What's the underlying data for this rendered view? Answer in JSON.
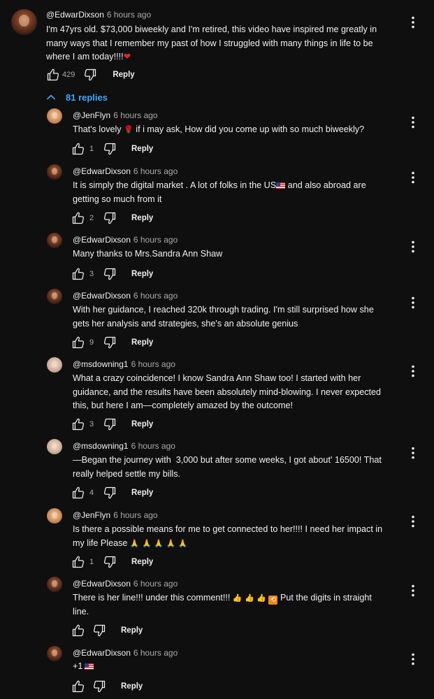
{
  "thread": {
    "top_comment": {
      "author": "@EdwarDixson",
      "time": "6 hours ago",
      "lines": [
        "I'm 47yrs old. $73,000 biweekly and I'm retired, this video have inspired me greatly in",
        "many ways that I remember my past of how I struggled with many things in life to be",
        "where I am today!!!!"
      ],
      "emoji": "❤",
      "likes": "429",
      "reply_label": "Reply"
    },
    "replies_toggle": {
      "label": "81 replies",
      "icon": "chevron-up-icon"
    },
    "replies": [
      {
        "author": "@JenFlyn",
        "time": "6 hours ago",
        "avatar": "jenflyn-avatar",
        "parts": [
          "That's lovely ",
          "🌹",
          " if i may ask, How did you come up with so much biweekly?"
        ],
        "likes": "1",
        "reply_label": "Reply"
      },
      {
        "author": "@EdwarDixson",
        "time": "6 hours ago",
        "avatar": "edwardixson-avatar",
        "line1a": "It is simply the digital market . A lot of folks in the US",
        "line1b": " and also abroad are",
        "line2": "getting so much from it",
        "likes": "2",
        "reply_label": "Reply"
      },
      {
        "author": "@EdwarDixson",
        "time": "6 hours ago",
        "avatar": "edwardixson-avatar",
        "line1": "Many thanks to Mrs.Sandra Ann Shaw",
        "likes": "3",
        "reply_label": "Reply"
      },
      {
        "author": "@EdwarDixson",
        "time": "6 hours ago",
        "avatar": "edwardixson-avatar",
        "line1": "With her guidance, I reached 320k through trading. I'm still surprised how she",
        "line2": "gets her analysis and strategies, she's an absolute genius",
        "likes": "9",
        "reply_label": "Reply"
      },
      {
        "author": "@msdowning1",
        "time": "6 hours ago",
        "avatar": "msdowning1-avatar",
        "line1": "What a crazy coincidence! I know Sandra Ann Shaw too! I started with her",
        "line2": "guidance, and the results have been absolutely mind-blowing. I never expected",
        "line3": "this, but here I am—completely amazed by the outcome!",
        "likes": "3",
        "reply_label": "Reply"
      },
      {
        "author": "@msdowning1",
        "time": "6 hours ago",
        "avatar": "msdowning1-avatar",
        "line1": "—Began the journey with  3,000 but after some weeks, I got about' 16500! That",
        "line2": "really helped settle my bills.",
        "likes": "4",
        "reply_label": "Reply"
      },
      {
        "author": "@JenFlyn",
        "time": "6 hours ago",
        "avatar": "jenflyn-avatar",
        "line1": "Is there a possible means for me to get connected to her!!!! I need her impact in",
        "line2a": "my life Please ",
        "emoji": "🙏 🙏 🙏 🙏 🙏",
        "likes": "1",
        "reply_label": "Reply"
      },
      {
        "author": "@EdwarDixson",
        "time": "6 hours ago",
        "avatar": "edwardixson-avatar",
        "line1a": "There is her line!!! under this comment!!! ",
        "emoji_thumbs": "👍 👍 👍",
        "emoji_repeat": "🔁",
        "line1b": " Put the digits in straight",
        "line2": "line.",
        "likes": "",
        "reply_label": "Reply"
      },
      {
        "author": "@EdwarDixson",
        "time": "6 hours ago",
        "avatar": "edwardixson-avatar",
        "line1": "+1",
        "likes": "",
        "reply_label": "Reply"
      }
    ]
  },
  "icons": {
    "like": "thumbs-up-icon",
    "dislike": "thumbs-down-icon",
    "more": "more-vertical-icon",
    "flag": "us-flag-emoji"
  },
  "colors": {
    "background": "#0f0f0f",
    "text": "#f1f1f1",
    "secondary": "#aaaaaa",
    "link": "#3ea6ff",
    "heart": "#e3262b"
  }
}
